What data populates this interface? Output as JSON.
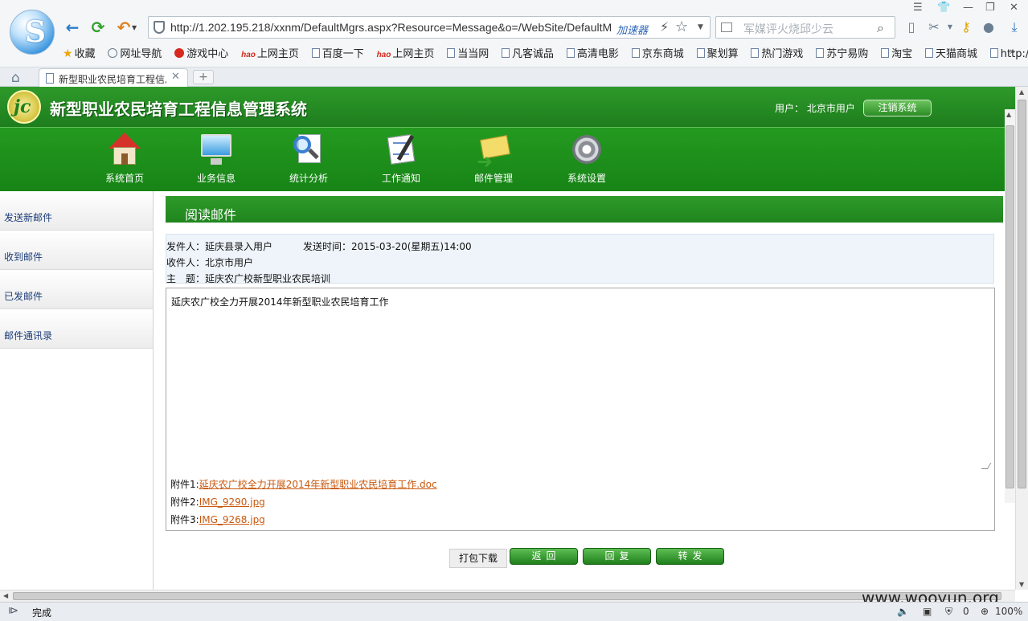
{
  "browser": {
    "url": "http://1.202.195.218/xxnm/DefaultMgrs.aspx?Resource=Message&o=/WebSite/DefaultM",
    "accelerator": "加速器",
    "search_placeholder": "军媒评火烧邱少云",
    "bookmarks": [
      {
        "label": "收藏",
        "icon": "star-icon"
      },
      {
        "label": "网址导航",
        "icon": "globe-icon"
      },
      {
        "label": "游戏中心",
        "icon": "game-icon"
      },
      {
        "label": "上网主页",
        "icon": "hao-icon",
        "prefix": "hao"
      },
      {
        "label": "百度一下",
        "icon": "page-icon"
      },
      {
        "label": "上网主页",
        "icon": "hao-icon",
        "prefix": "hao"
      },
      {
        "label": "当当网",
        "icon": "page-icon"
      },
      {
        "label": "凡客诚品",
        "icon": "page-icon"
      },
      {
        "label": "高清电影",
        "icon": "page-icon"
      },
      {
        "label": "京东商城",
        "icon": "page-icon"
      },
      {
        "label": "聚划算",
        "icon": "page-icon"
      },
      {
        "label": "热门游戏",
        "icon": "page-icon"
      },
      {
        "label": "苏宁易购",
        "icon": "page-icon"
      },
      {
        "label": "淘宝",
        "icon": "page-icon"
      },
      {
        "label": "天猫商城",
        "icon": "page-icon"
      },
      {
        "label": "http://",
        "icon": "page-icon"
      }
    ],
    "tab_title": "新型职业农民培育工程信息管理系统",
    "new_tab": "+",
    "status_text": "完成",
    "status_counter": "0",
    "zoom": "100%"
  },
  "app": {
    "title": "新型职业农民培育工程信息管理系统",
    "user_label": "用户： 北京市用户",
    "logout_label": "注销系统",
    "menu": [
      {
        "label": "系统首页",
        "icon": "home-icon"
      },
      {
        "label": "业务信息",
        "icon": "monitor-icon"
      },
      {
        "label": "统计分析",
        "icon": "magnifier-icon"
      },
      {
        "label": "工作通知",
        "icon": "notice-icon"
      },
      {
        "label": "邮件管理",
        "icon": "mail-icon"
      },
      {
        "label": "系统设置",
        "icon": "gear-icon"
      }
    ],
    "sidebar": [
      {
        "label": "发送新邮件"
      },
      {
        "label": "收到邮件"
      },
      {
        "label": "已发邮件"
      },
      {
        "label": "邮件通讯录"
      }
    ]
  },
  "mail": {
    "section_title": "阅读邮件",
    "sender_line": "发件人：延庆县录入用户",
    "time_line": "发送时间：2015-03-20(星期五)14:00",
    "recipient_line": "收件人：北京市用户",
    "subject_line": "主　题：延庆农广校新型职业农民培训",
    "body": "延庆农广校全力开展2014年新型职业农民培育工作",
    "attachments": [
      {
        "prefix": "附件1:",
        "name": "延庆农广校全力开展2014年新型职业农民培育工作.doc"
      },
      {
        "prefix": "附件2:",
        "name": "IMG_9290.jpg"
      },
      {
        "prefix": "附件3:",
        "name": "IMG_9268.jpg"
      }
    ],
    "buttons": {
      "download": "打包下载",
      "back": "返回",
      "reply": "回复",
      "forward": "转发"
    }
  },
  "watermark": "www.wooyun.org"
}
